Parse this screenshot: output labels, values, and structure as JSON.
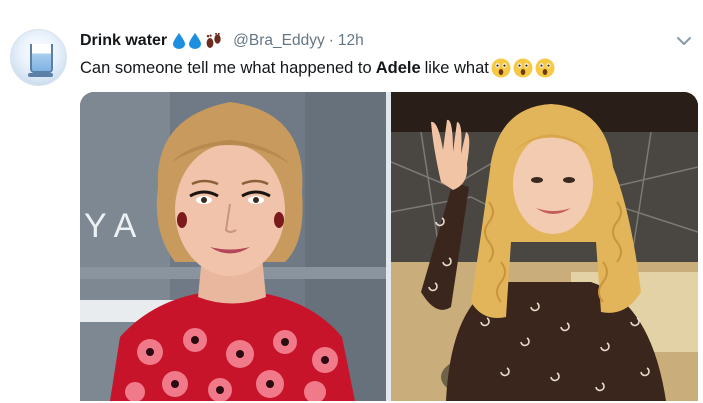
{
  "tweet": {
    "display_name": "Drink water",
    "name_emojis": [
      "droplet-icon",
      "droplet-icon",
      "footprints-icon"
    ],
    "handle": "@Bra_Eddyy",
    "separator": "·",
    "time": "12h",
    "text_before": "Can someone tell me what happened to",
    "text_bold": "Adele",
    "text_after": "like what",
    "text_emojis": [
      "astonished-face-icon",
      "astonished-face-icon",
      "astonished-face-icon"
    ],
    "menu_icon": "chevron-down-icon"
  },
  "media": {
    "left_image": "grammy-red-carpet-photo",
    "right_image": "curly-hair-waving-photo",
    "left_backdrop_text": "Y A"
  },
  "colors": {
    "text_primary": "#14171a",
    "text_secondary": "#657786",
    "droplet": "#1d8fe1",
    "emoji_yellow": "#f6c945"
  }
}
